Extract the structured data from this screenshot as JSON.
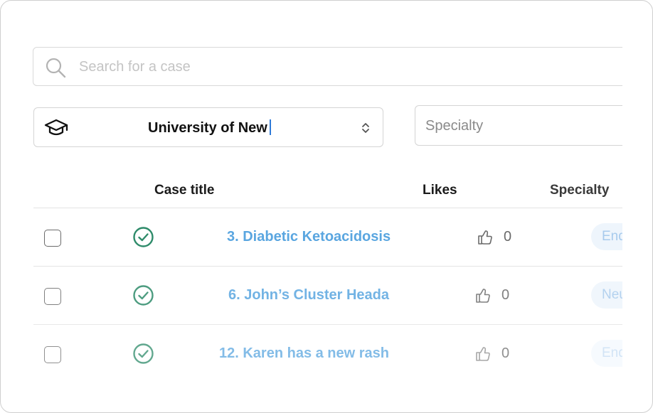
{
  "search": {
    "placeholder": "Search for a case",
    "value": ""
  },
  "filters": {
    "university": {
      "value": "University of New"
    },
    "specialty": {
      "placeholder": "Specialty"
    }
  },
  "table": {
    "headers": {
      "title": "Case title",
      "likes": "Likes",
      "specialty": "Specialty"
    },
    "rows": [
      {
        "title": "3. Diabetic Ketoacidosis",
        "likes": "0",
        "specialty": "End",
        "status_icon": "check-circle-icon"
      },
      {
        "title": "6. John’s Cluster Heada",
        "likes": "0",
        "specialty": "Neu",
        "status_icon": "check-circle-icon"
      },
      {
        "title": "12. Karen has a new rash",
        "likes": "0",
        "specialty": "End",
        "status_icon": "check-circle-icon"
      }
    ]
  },
  "colors": {
    "link": "#5aa6e0",
    "success": "#2e8b6a",
    "chip_bg": "#eef5fc"
  }
}
